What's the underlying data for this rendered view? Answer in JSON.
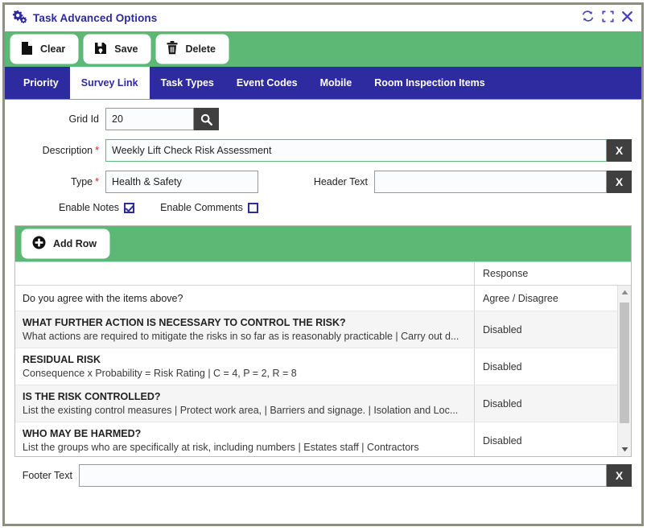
{
  "window": {
    "title": "Task Advanced Options",
    "title_icon": "cogs-icon",
    "refresh_icon": "refresh-icon",
    "maximize_icon": "expand-icon",
    "close_icon": "close-icon"
  },
  "colors": {
    "accent_green": "#5cb874",
    "accent_blue": "#2e2aa0",
    "dark_button": "#3f3f3f",
    "required_red": "#e02020",
    "window_border": "#8e8f7e"
  },
  "toolbar": {
    "buttons": [
      {
        "label": "Clear",
        "icon": "file-icon"
      },
      {
        "label": "Save",
        "icon": "floppy-disk-icon"
      },
      {
        "label": "Delete",
        "icon": "trash-icon"
      }
    ]
  },
  "tabs": [
    {
      "label": "Priority",
      "active": false
    },
    {
      "label": "Survey Link",
      "active": true
    },
    {
      "label": "Task Types",
      "active": false
    },
    {
      "label": "Event Codes",
      "active": false
    },
    {
      "label": "Mobile",
      "active": false
    },
    {
      "label": "Room Inspection Items",
      "active": false
    }
  ],
  "form": {
    "grid_id": {
      "label": "Grid Id",
      "value": "20",
      "placeholder": "",
      "search_icon": "search-icon"
    },
    "description": {
      "label": "Description",
      "required": "*",
      "value": "Weekly Lift Check Risk Assessment",
      "placeholder": "",
      "clear_icon": "X"
    },
    "type": {
      "label": "Type",
      "required": "*",
      "value": "Health & Safety",
      "placeholder": ""
    },
    "header_text": {
      "label": "Header Text",
      "value": "",
      "placeholder": "",
      "clear_icon": "X"
    },
    "enable_notes": {
      "label": "Enable Notes",
      "checked": true
    },
    "enable_comments": {
      "label": "Enable Comments",
      "checked": false
    }
  },
  "grid": {
    "add_row_button": {
      "label": "Add Row",
      "icon": "plus-circle-icon"
    },
    "columns": [
      "",
      "Response"
    ],
    "rows": [
      {
        "title": "Do you agree with the items above?",
        "subtitle": "",
        "bold": false,
        "response": "Agree / Disagree"
      },
      {
        "title": "WHAT FURTHER ACTION IS NECESSARY TO CONTROL THE RISK?",
        "subtitle": "What actions are required to mitigate the risks in so far as is reasonably practicable | Carry out d...",
        "bold": true,
        "response": "Disabled"
      },
      {
        "title": "RESIDUAL RISK",
        "subtitle": "Consequence x Probability = Risk Rating | C = 4, P = 2, R = 8",
        "bold": true,
        "response": "Disabled"
      },
      {
        "title": "IS THE RISK CONTROLLED?",
        "subtitle": "List the existing control measures | Protect work area, | Barriers and signage. | Isolation and Loc...",
        "bold": true,
        "response": "Disabled"
      },
      {
        "title": "WHO MAY BE HARMED?",
        "subtitle": "List the groups who are specifically at risk, including numbers | Estates staff | Contractors",
        "bold": true,
        "response": "Disabled"
      }
    ],
    "scrollbar": {
      "up_arrow": "▲",
      "down_arrow": "▼"
    }
  },
  "footer": {
    "label": "Footer Text",
    "value": "",
    "placeholder": "",
    "clear_icon": "X"
  }
}
